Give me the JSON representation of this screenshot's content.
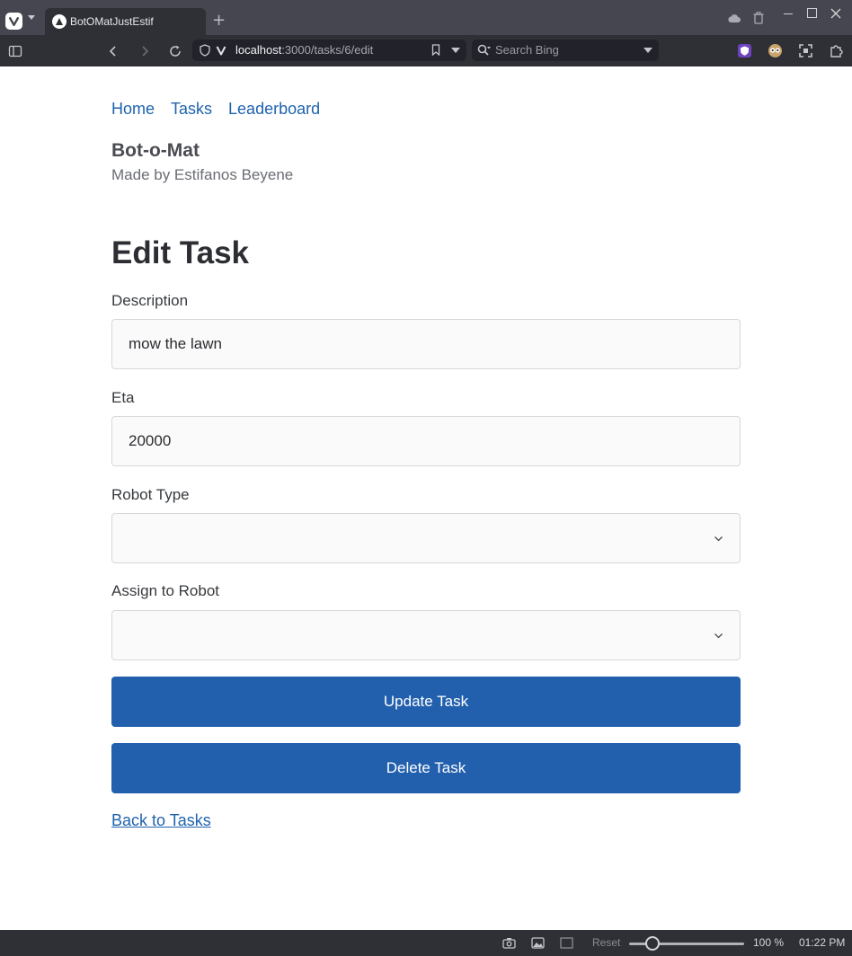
{
  "browser": {
    "tab_title": "BotOMatJustEstif",
    "url_host": "localhost",
    "url_path": ":3000/tasks/6/edit",
    "search_placeholder": "Search Bing",
    "zoom_reset_label": "Reset",
    "zoom_level": "100 %",
    "zoom_fraction": 0.2,
    "time": "01:22 PM"
  },
  "nav": {
    "home": "Home",
    "tasks": "Tasks",
    "leaderboard": "Leaderboard"
  },
  "header": {
    "brand": "Bot-o-Mat",
    "subtitle": "Made by Estifanos Beyene"
  },
  "form": {
    "title": "Edit Task",
    "description_label": "Description",
    "description_value": "mow the lawn",
    "eta_label": "Eta",
    "eta_value": "20000",
    "robot_type_label": "Robot Type",
    "robot_type_value": "",
    "assign_label": "Assign to Robot",
    "assign_value": "",
    "update_button": "Update Task",
    "delete_button": "Delete Task",
    "back_link": "Back to Tasks"
  },
  "colors": {
    "primary": "#2260ad",
    "link": "#1f63ad"
  }
}
